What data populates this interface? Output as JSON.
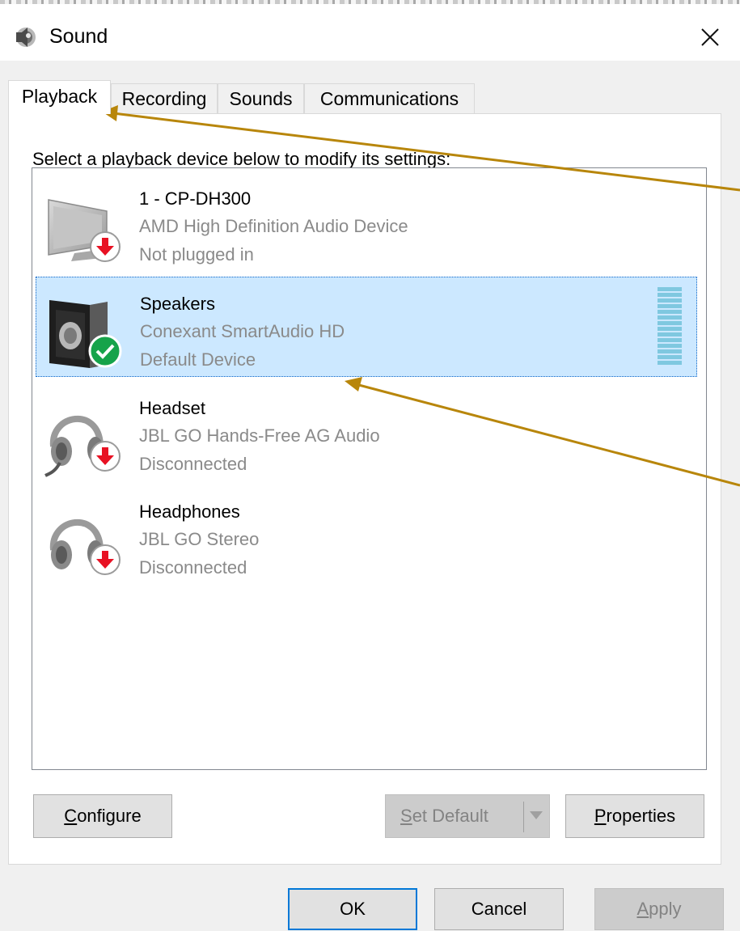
{
  "window": {
    "title": "Sound",
    "icon": "speaker-icon",
    "close_icon": "close-icon"
  },
  "tabs": [
    {
      "label": "Playback",
      "active": true
    },
    {
      "label": "Recording",
      "active": false
    },
    {
      "label": "Sounds",
      "active": false
    },
    {
      "label": "Communications",
      "active": false
    }
  ],
  "playback": {
    "prompt": "Select a playback device below to modify its settings:",
    "devices": [
      {
        "name": "1 - CP-DH300",
        "description": "AMD High Definition Audio Device",
        "status": "Not plugged in",
        "icon": "monitor-icon",
        "badge": "disconnected-arrow-icon",
        "selected": false
      },
      {
        "name": "Speakers",
        "description": "Conexant SmartAudio HD",
        "status": "Default Device",
        "icon": "speaker-device-icon",
        "badge": "default-check-icon",
        "selected": true
      },
      {
        "name": "Headset",
        "description": "JBL GO Hands-Free AG Audio",
        "status": "Disconnected",
        "icon": "headset-icon",
        "badge": "disconnected-arrow-icon",
        "selected": false
      },
      {
        "name": "Headphones",
        "description": "JBL GO Stereo",
        "status": "Disconnected",
        "icon": "headphones-icon",
        "badge": "disconnected-arrow-icon",
        "selected": false
      }
    ],
    "buttons": {
      "configure_mnemonic": "C",
      "configure_rest": "onfigure",
      "set_default_mnemonic": "S",
      "set_default_rest": "et Default",
      "properties_mnemonic": "P",
      "properties_rest": "roperties"
    }
  },
  "footer": {
    "ok": "OK",
    "cancel": "Cancel",
    "apply_mnemonic": "A",
    "apply_rest": "pply"
  },
  "colors": {
    "selection": "#cce8ff",
    "annotation_arrow": "#b8860b",
    "badge_red": "#e81123",
    "badge_green": "#16a34a"
  }
}
